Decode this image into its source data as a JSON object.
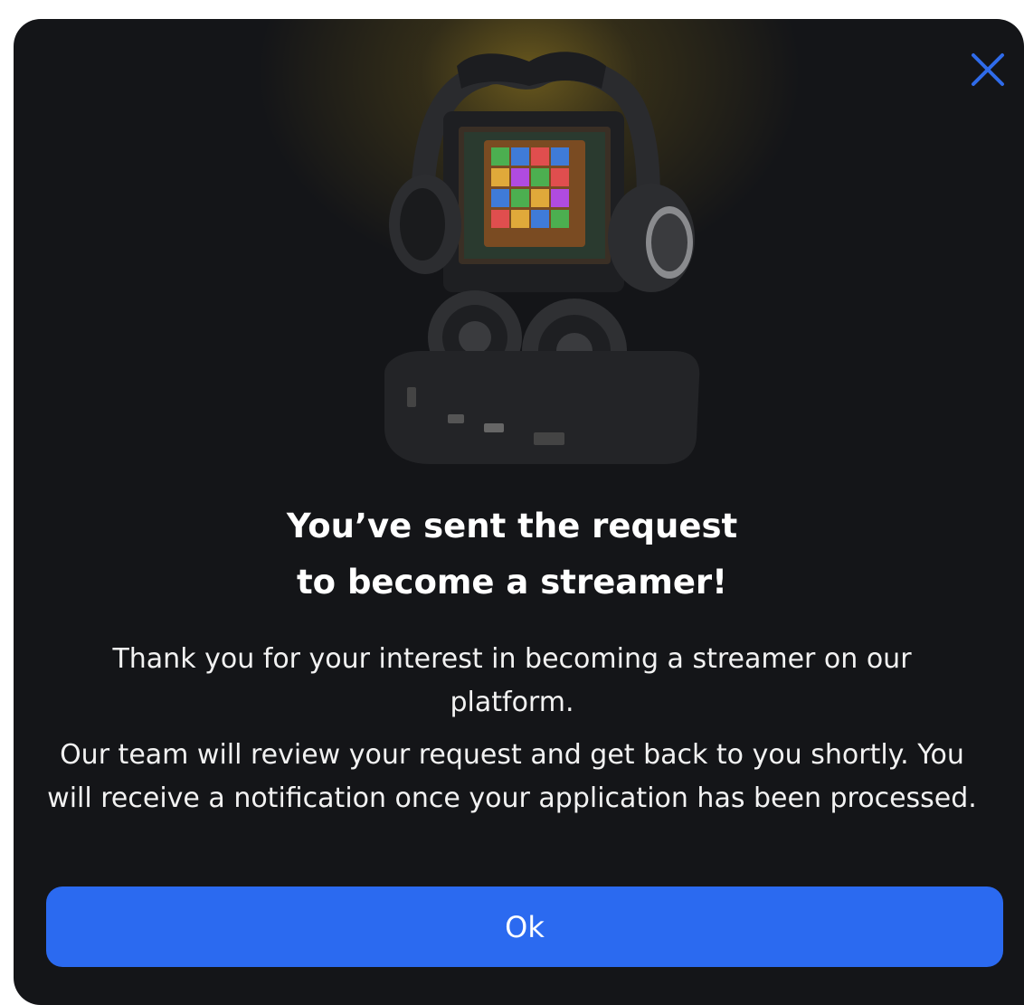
{
  "dialog": {
    "title_line1": "You’ve sent the request",
    "title_line2": "to become a streamer!",
    "paragraph1": "Thank you for your interest in becoming a streamer on our platform.",
    "paragraph2": "Our team will review your request and get back to you shortly. You will receive a notification once your application has been processed.",
    "ok_label": "Ok",
    "close_icon": "close-icon",
    "hero_image": "streamer-gear-image"
  },
  "colors": {
    "background": "#141518",
    "accent": "#2b6af0",
    "close_icon": "#2f6bea",
    "text": "#ffffff"
  }
}
